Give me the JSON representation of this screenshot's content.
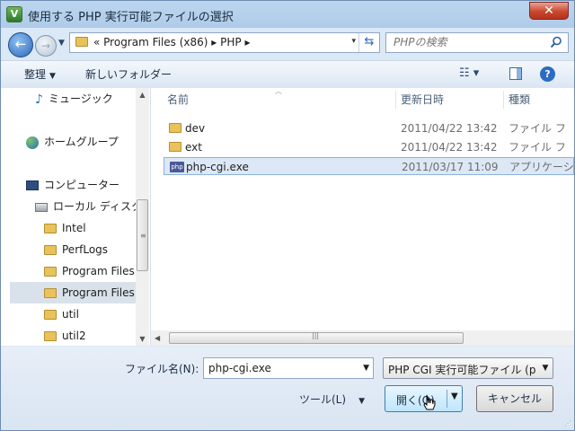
{
  "window": {
    "title": "使用する PHP 実行可能ファイルの選択",
    "app_icon_letter": "V",
    "close_glyph": "✕"
  },
  "nav": {
    "back_glyph": "←",
    "forward_glyph": "→",
    "history_glyph": "▼",
    "address_text": "« Program Files (x86) ▸ PHP ▸",
    "address_dropdown_glyph": "▾",
    "refresh_glyph": "⇆",
    "search_placeholder": "PHPの検索"
  },
  "toolbar": {
    "organize_label": "整理",
    "new_folder_label": "新しいフォルダー",
    "caret": "▼",
    "view_glyph": "☷ ▾",
    "help_glyph": "?"
  },
  "sidebar": {
    "items": [
      {
        "label": "ミュージック",
        "icon": "music-icon"
      },
      {
        "label": "ホームグループ",
        "icon": "homegroup-icon"
      },
      {
        "label": "コンピューター",
        "icon": "computer-icon"
      },
      {
        "label": "ローカル ディスク",
        "icon": "drive-icon"
      },
      {
        "label": "Intel",
        "icon": "folder-icon"
      },
      {
        "label": "PerfLogs",
        "icon": "folder-icon"
      },
      {
        "label": "Program Files",
        "icon": "folder-icon"
      },
      {
        "label": "Program Files",
        "icon": "folder-icon"
      },
      {
        "label": "util",
        "icon": "folder-icon"
      },
      {
        "label": "util2",
        "icon": "folder-icon"
      }
    ],
    "selected_index": 7
  },
  "files": {
    "columns": [
      "名前",
      "更新日時",
      "種類"
    ],
    "rows": [
      {
        "name": "dev",
        "date": "2011/04/22 13:42",
        "type": "ファイル フ",
        "icon": "folder-icon"
      },
      {
        "name": "ext",
        "date": "2011/04/22 13:42",
        "type": "ファイル フ",
        "icon": "folder-icon"
      },
      {
        "name": "php-cgi.exe",
        "date": "2011/03/17 11:09",
        "type": "アプリケーシ",
        "icon": "php-icon",
        "icon_text": "php"
      }
    ],
    "selected_index": 2
  },
  "footer": {
    "filename_label": "ファイル名(N):",
    "filename_value": "php-cgi.exe",
    "filetype_value": "PHP CGI 実行可能ファイル (p",
    "tools_label": "ツール(L)",
    "tools_caret": "▼",
    "open_label": "開く(O)",
    "cancel_label": "キャンセル"
  },
  "colors": {
    "selection": "#dde8f6",
    "selection_border": "#8bb3df",
    "close_red": "#c9482f",
    "accent_blue": "#2b66b8"
  }
}
